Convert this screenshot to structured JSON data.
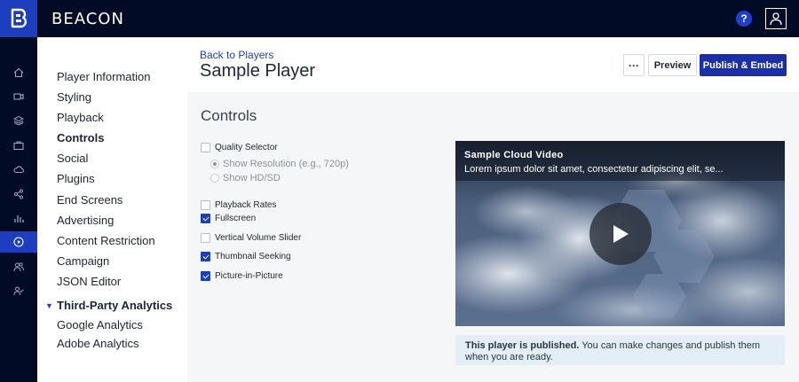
{
  "app": {
    "brand": "BEACON",
    "help_label": "?"
  },
  "rail": {
    "items": [
      {
        "name": "home-icon",
        "active": false
      },
      {
        "name": "video-camera-icon",
        "active": false
      },
      {
        "name": "layers-icon",
        "active": false
      },
      {
        "name": "briefcase-icon",
        "active": false
      },
      {
        "name": "cloud-icon",
        "active": false
      },
      {
        "name": "share-icon",
        "active": false
      },
      {
        "name": "analytics-icon",
        "active": false
      },
      {
        "name": "player-icon",
        "active": true
      },
      {
        "name": "users-icon",
        "active": false
      },
      {
        "name": "user-check-icon",
        "active": false
      }
    ]
  },
  "subnav": {
    "items": [
      {
        "label": "Player Information",
        "active": false
      },
      {
        "label": "Styling",
        "active": false
      },
      {
        "label": "Playback",
        "active": false
      },
      {
        "label": "Controls",
        "active": true
      },
      {
        "label": "Social",
        "active": false
      },
      {
        "label": "Plugins",
        "active": false
      },
      {
        "label": "End Screens",
        "active": false
      },
      {
        "label": "Advertising",
        "active": false
      },
      {
        "label": "Content Restriction",
        "active": false
      },
      {
        "label": "Campaign",
        "active": false
      },
      {
        "label": "JSON Editor",
        "active": false
      }
    ],
    "group": {
      "label": "Third-Party Analytics",
      "items": [
        "Google Analytics",
        "Adobe Analytics"
      ]
    }
  },
  "header": {
    "back_link": "Back to Players",
    "title": "Sample Player",
    "more_label": "···",
    "preview_label": "Preview",
    "publish_label": "Publish & Embed"
  },
  "controls": {
    "section_title": "Controls",
    "quality_selector": {
      "label": "Quality Selector",
      "checked": false
    },
    "quality_options": [
      {
        "label": "Show Resolution (e.g., 720p)",
        "selected": true
      },
      {
        "label": "Show HD/SD",
        "selected": false
      }
    ],
    "options": [
      {
        "label": "Playback Rates",
        "checked": false
      },
      {
        "label": "Fullscreen",
        "checked": true
      },
      {
        "label": "Vertical Volume Slider",
        "checked": false
      },
      {
        "label": "Thumbnail Seeking",
        "checked": true
      },
      {
        "label": "Picture-in-Picture",
        "checked": true
      }
    ]
  },
  "preview": {
    "video_title": "Sample Cloud Video",
    "video_description": "Lorem ipsum dolor sit amet, consectetur adipiscing elit, se..."
  },
  "notice": {
    "bold": "This player is published.",
    "text": " You can make changes and publish them when you are ready."
  },
  "colors": {
    "nav_bg": "#020b26",
    "accent": "#1d3fbf",
    "primary_button": "#1a2fa8",
    "notice_bg": "#e3eef7"
  }
}
